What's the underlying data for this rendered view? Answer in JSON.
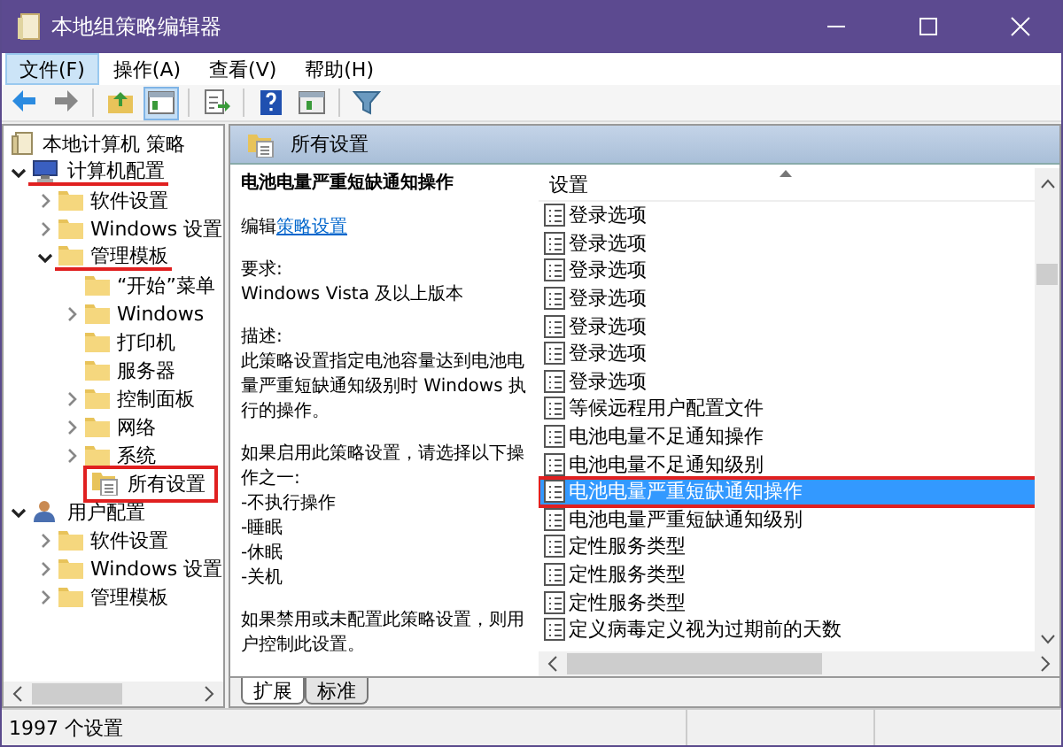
{
  "window": {
    "title": "本地组策略编辑器"
  },
  "menu": [
    {
      "label": "文件(F)",
      "selected": true
    },
    {
      "label": "操作(A)",
      "selected": false
    },
    {
      "label": "查看(V)",
      "selected": false
    },
    {
      "label": "帮助(H)",
      "selected": false
    }
  ],
  "toolbar": [
    {
      "kind": "back",
      "pressed": false
    },
    {
      "kind": "forward",
      "pressed": false
    },
    {
      "kind": "separator"
    },
    {
      "kind": "up",
      "pressed": false
    },
    {
      "kind": "pane",
      "pressed": true
    },
    {
      "kind": "separator"
    },
    {
      "kind": "export",
      "pressed": false
    },
    {
      "kind": "separator"
    },
    {
      "kind": "help",
      "pressed": false
    },
    {
      "kind": "pane2",
      "pressed": false
    },
    {
      "kind": "separator"
    },
    {
      "kind": "filter",
      "pressed": false
    }
  ],
  "tree": [
    {
      "label": "本地计算机 策略",
      "kind": "root",
      "underlined": false,
      "boxed": false,
      "children": [
        {
          "label": "计算机配置",
          "kind": "computer",
          "expandable": true,
          "expanded": true,
          "underlined": true,
          "boxed": false,
          "children": [
            {
              "label": "软件设置",
              "kind": "folder",
              "expandable": true,
              "expanded": false,
              "underlined": false,
              "boxed": false
            },
            {
              "label": "Windows 设置",
              "kind": "folder",
              "expandable": true,
              "expanded": false,
              "underlined": false,
              "boxed": false
            },
            {
              "label": "管理模板",
              "kind": "folder",
              "expandable": true,
              "expanded": true,
              "underlined": true,
              "boxed": false,
              "children": [
                {
                  "label": "“开始”菜单",
                  "kind": "folder",
                  "expandable": false,
                  "underlined": false,
                  "boxed": false
                },
                {
                  "label": "Windows",
                  "kind": "folder",
                  "expandable": true,
                  "expanded": false,
                  "underlined": false,
                  "boxed": false
                },
                {
                  "label": "打印机",
                  "kind": "folder",
                  "expandable": false,
                  "underlined": false,
                  "boxed": false
                },
                {
                  "label": "服务器",
                  "kind": "folder",
                  "expandable": false,
                  "underlined": false,
                  "boxed": false
                },
                {
                  "label": "控制面板",
                  "kind": "folder",
                  "expandable": true,
                  "expanded": false,
                  "underlined": false,
                  "boxed": false
                },
                {
                  "label": "网络",
                  "kind": "folder",
                  "expandable": true,
                  "expanded": false,
                  "underlined": false,
                  "boxed": false
                },
                {
                  "label": "系统",
                  "kind": "folder",
                  "expandable": true,
                  "expanded": false,
                  "underlined": false,
                  "boxed": false
                },
                {
                  "label": "所有设置",
                  "kind": "all",
                  "expandable": false,
                  "underlined": false,
                  "boxed": true
                }
              ]
            }
          ]
        },
        {
          "label": "用户配置",
          "kind": "user",
          "expandable": true,
          "expanded": true,
          "underlined": false,
          "boxed": false,
          "children": [
            {
              "label": "软件设置",
              "kind": "folder",
              "expandable": true,
              "expanded": false,
              "underlined": false,
              "boxed": false
            },
            {
              "label": "Windows 设置",
              "kind": "folder",
              "expandable": true,
              "expanded": false,
              "underlined": false,
              "boxed": false
            },
            {
              "label": "管理模板",
              "kind": "folder",
              "expandable": true,
              "expanded": false,
              "underlined": false,
              "boxed": false
            }
          ]
        }
      ]
    }
  ],
  "header": {
    "title": "所有设置"
  },
  "description": {
    "title": "电池电量严重短缺通知操作",
    "edit_prefix": "编辑",
    "edit_link": "策略设置",
    "paragraphs": [
      "要求:\nWindows Vista 及以上版本",
      "描述:\n此策略设置指定电池容量达到电池电量严重短缺通知级别时 Windows 执行的操作。",
      "如果启用此策略设置，请选择以下操作之一:\n-不执行操作\n-睡眠\n-休眠\n-关机",
      "如果禁用或未配置此策略设置，则用户控制此设置。"
    ]
  },
  "list": {
    "column": "设置",
    "rows": [
      {
        "label": "登录选项",
        "selected": false,
        "boxed": false
      },
      {
        "label": "登录选项",
        "selected": false,
        "boxed": false
      },
      {
        "label": "登录选项",
        "selected": false,
        "boxed": false
      },
      {
        "label": "登录选项",
        "selected": false,
        "boxed": false
      },
      {
        "label": "登录选项",
        "selected": false,
        "boxed": false
      },
      {
        "label": "登录选项",
        "selected": false,
        "boxed": false
      },
      {
        "label": "登录选项",
        "selected": false,
        "boxed": false
      },
      {
        "label": "等候远程用户配置文件",
        "selected": false,
        "boxed": false
      },
      {
        "label": "电池电量不足通知操作",
        "selected": false,
        "boxed": false
      },
      {
        "label": "电池电量不足通知级别",
        "selected": false,
        "boxed": false
      },
      {
        "label": "电池电量严重短缺通知操作",
        "selected": true,
        "boxed": true
      },
      {
        "label": "电池电量严重短缺通知级别",
        "selected": false,
        "boxed": false
      },
      {
        "label": "定性服务类型",
        "selected": false,
        "boxed": false
      },
      {
        "label": "定性服务类型",
        "selected": false,
        "boxed": false
      },
      {
        "label": "定性服务类型",
        "selected": false,
        "boxed": false
      },
      {
        "label": "定义病毒定义视为过期前的天数",
        "selected": false,
        "boxed": false
      }
    ]
  },
  "view_tabs": [
    {
      "label": "扩展",
      "selected": true
    },
    {
      "label": "标准",
      "selected": false
    }
  ],
  "status_bar": {
    "text": "1997 个设置"
  }
}
